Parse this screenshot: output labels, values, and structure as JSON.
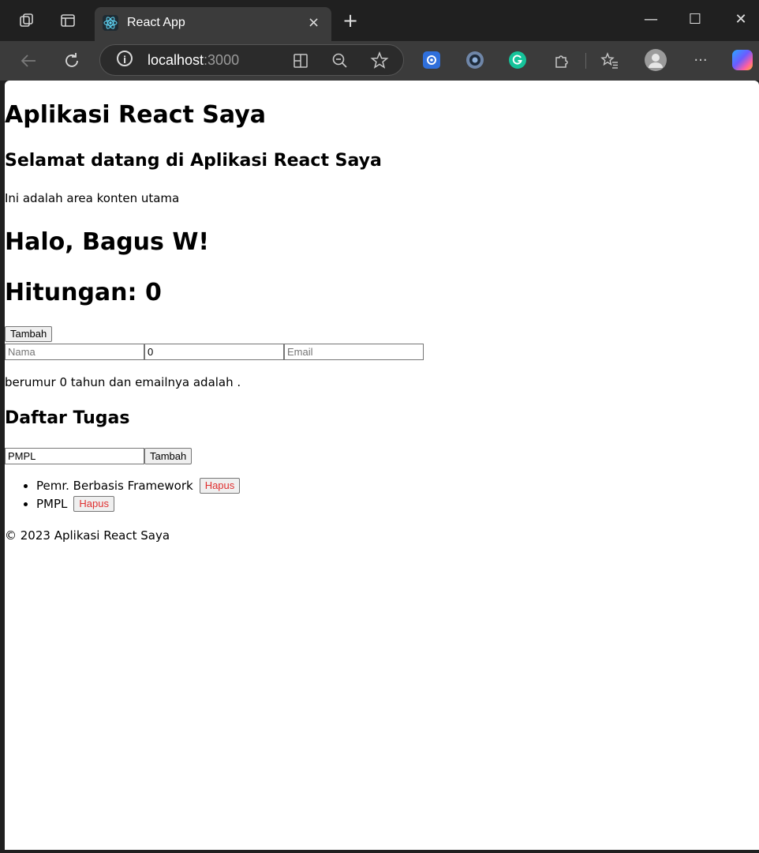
{
  "browser": {
    "tab_title": "React App",
    "url_host": "localhost",
    "url_port": ":3000",
    "tab_close_glyph": "×",
    "new_tab_glyph": "+",
    "minimize_glyph": "—",
    "maximize_glyph": "☐",
    "close_glyph": "✕",
    "info_glyph": "i",
    "more_glyph": "···",
    "icons": [
      "workspaces-icon",
      "tab-actions-icon",
      "back-icon",
      "refresh-icon",
      "site-info-icon",
      "split-screen-icon",
      "zoom-out-icon",
      "favorite-star-icon",
      "extensions-icon",
      "favorites-icon",
      "profile-avatar-icon",
      "more-menu-icon",
      "copilot-icon"
    ],
    "colors": {
      "frame": "#202020",
      "toolbar": "#3b3b3b",
      "accent_ext1": "#2f6fdb",
      "accent_grammarly": "#15c39a"
    }
  },
  "page": {
    "app_title": "Aplikasi React Saya",
    "welcome": "Selamat datang di Aplikasi React Saya",
    "content_text": "Ini adalah area konten utama",
    "greeting": "Halo, Bagus W!",
    "counter_text": "Hitungan: 0",
    "add_button": "Tambah",
    "form": {
      "name_placeholder": "Nama",
      "age_value": "0",
      "email_placeholder": "Email"
    },
    "age_text": "berumur 0 tahun dan emailnya adalah .",
    "tasks_title": "Daftar Tugas",
    "task_input_value": "PMPL",
    "task_add_button": "Tambah",
    "tasks": [
      {
        "label": "Pemr. Berbasis Framework",
        "delete_label": "Hapus"
      },
      {
        "label": "PMPL",
        "delete_label": "Hapus"
      }
    ],
    "footer": "© 2023 Aplikasi React Saya",
    "colors": {
      "delete_text": "#e03030"
    }
  }
}
